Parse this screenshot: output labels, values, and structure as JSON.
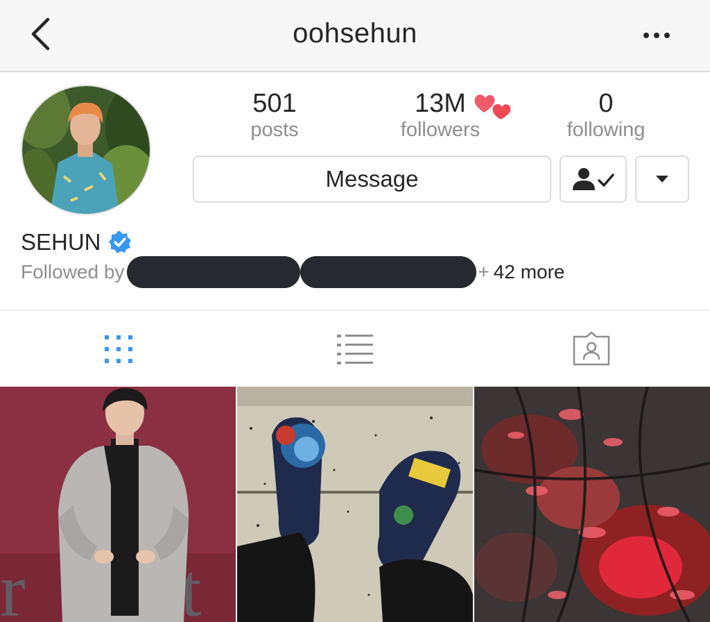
{
  "header": {
    "username": "oohsehun"
  },
  "profile": {
    "stats": [
      {
        "value": "501",
        "label": "posts"
      },
      {
        "value": "13M",
        "label": "followers"
      },
      {
        "value": "0",
        "label": "following"
      }
    ],
    "message_label": "Message",
    "full_name": "SEHUN",
    "followed_by_prefix": "Followed by",
    "followed_by_suffix": "42 more",
    "plus_sign": "+"
  },
  "colors": {
    "verified_badge": "#3897f0",
    "active_tab": "#3897f0",
    "heart": "#ed4956",
    "redaction": "#262a2f"
  },
  "tabs": [
    {
      "name": "grid",
      "icon": "grid-icon",
      "active": true
    },
    {
      "name": "list",
      "icon": "list-icon",
      "active": false
    },
    {
      "name": "tagged",
      "icon": "tagged-person-icon",
      "active": false
    }
  ],
  "posts": [
    {
      "icon": "photo-man-in-suit"
    },
    {
      "icon": "photo-painted-shoes"
    },
    {
      "icon": "photo-red-embers"
    }
  ]
}
